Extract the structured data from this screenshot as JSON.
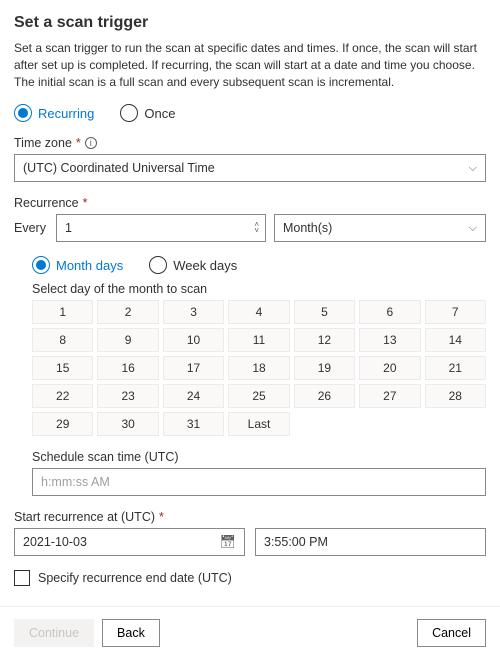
{
  "title": "Set a scan trigger",
  "description": "Set a scan trigger to run the scan at specific dates and times. If once, the scan will start after set up is completed. If recurring, the scan will start at a date and time you choose. The initial scan is a full scan and every subsequent scan is incremental.",
  "trigger_type": {
    "recurring": "Recurring",
    "once": "Once"
  },
  "timezone": {
    "label": "Time zone",
    "value": "(UTC) Coordinated Universal Time"
  },
  "recurrence": {
    "label": "Recurrence",
    "every_label": "Every",
    "every_value": "1",
    "unit": "Month(s)",
    "mode": {
      "month_days": "Month days",
      "week_days": "Week days"
    },
    "select_day_label": "Select day of the month to scan",
    "days": [
      "1",
      "2",
      "3",
      "4",
      "5",
      "6",
      "7",
      "8",
      "9",
      "10",
      "11",
      "12",
      "13",
      "14",
      "15",
      "16",
      "17",
      "18",
      "19",
      "20",
      "21",
      "22",
      "23",
      "24",
      "25",
      "26",
      "27",
      "28",
      "29",
      "30",
      "31",
      "Last"
    ],
    "schedule_time_label": "Schedule scan time (UTC)",
    "schedule_time_placeholder": "h:mm:ss AM"
  },
  "start": {
    "label": "Start recurrence at (UTC)",
    "date": "2021-10-03",
    "time": "3:55:00 PM"
  },
  "end": {
    "checkbox_label": "Specify recurrence end date (UTC)"
  },
  "footer": {
    "continue": "Continue",
    "back": "Back",
    "cancel": "Cancel"
  }
}
